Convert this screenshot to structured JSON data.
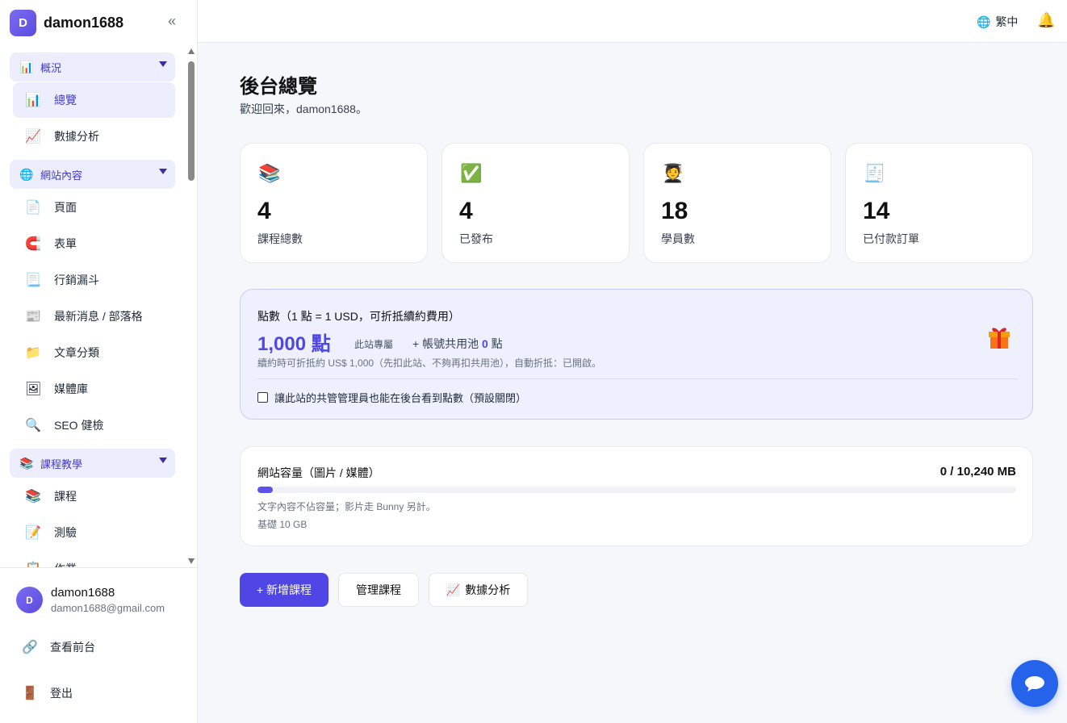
{
  "brand": {
    "initial": "D",
    "name": "damon1688",
    "collapse": "«"
  },
  "sidebar": {
    "sections": [
      {
        "label": "概況",
        "icon": "📊"
      },
      {
        "label": "網站內容",
        "icon": "🌐"
      },
      {
        "label": "課程教學",
        "icon": "📚"
      }
    ],
    "items": [
      {
        "label": "總覽",
        "icon": "📊"
      },
      {
        "label": "數據分析",
        "icon": "📈"
      },
      {
        "label": "頁面",
        "icon": "📄"
      },
      {
        "label": "表單",
        "icon": "🧲"
      },
      {
        "label": "行銷漏斗",
        "icon": "📃"
      },
      {
        "label": "最新消息 / 部落格",
        "icon": "📰"
      },
      {
        "label": "文章分類",
        "icon": "📁"
      },
      {
        "label": "媒體庫",
        "icon": "🖼"
      },
      {
        "label": "SEO 健檢",
        "icon": "🔍"
      },
      {
        "label": "課程",
        "icon": "📚"
      },
      {
        "label": "測驗",
        "icon": "📝"
      },
      {
        "label": "作業",
        "icon": "📋"
      }
    ]
  },
  "user": {
    "initial": "D",
    "name": "damon1688",
    "email": "damon1688@gmail.com"
  },
  "bottom_links": [
    {
      "label": "查看前台",
      "icon": "🔗"
    },
    {
      "label": "登出",
      "icon": "🚪"
    }
  ],
  "topbar": {
    "language": "繁中",
    "language_icon": "🌐",
    "bell_icon": "🔔"
  },
  "main": {
    "title": "後台總覽",
    "subtitle": "歡迎回來，damon1688。",
    "stats": [
      {
        "value": "4",
        "label": "課程總數",
        "icon": "📚"
      },
      {
        "value": "4",
        "label": "已發布",
        "icon": "✅"
      },
      {
        "value": "18",
        "label": "學員數",
        "icon": "🧑‍🎓"
      },
      {
        "value": "14",
        "label": "已付款訂單",
        "icon": "🧾"
      }
    ],
    "points": {
      "title": "點數（1 點 = 1 USD，可折抵續約費用）",
      "amount": "1,000 點",
      "exclusive": "此站專屬",
      "pool_prefix": "+ 帳號共用池",
      "pool_value": "0",
      "pool_suffix": "點",
      "note": "續約時可折抵約 US$ 1,000（先扣此站、不夠再扣共用池），自動折抵：已開啟。",
      "checkbox_label": "讓此站的共管管理員也能在後台看到點數（預設關閉）",
      "checkbox_checked": false
    },
    "storage": {
      "title": "網站容量（圖片 / 媒體）",
      "usage": "0 / 10,240 MB",
      "fill_percent": 2,
      "note1": "文字內容不佔容量；影片走 Bunny 另計。",
      "note2": "基礎 10 GB"
    },
    "buttons": {
      "add_course": "+ 新增課程",
      "manage_course": "管理課程",
      "analytics": "數據分析",
      "analytics_icon": "📈"
    }
  },
  "colors": {
    "accent": "#4f46e5",
    "chat": "#2563eb",
    "section_bg": "#eceefe"
  }
}
